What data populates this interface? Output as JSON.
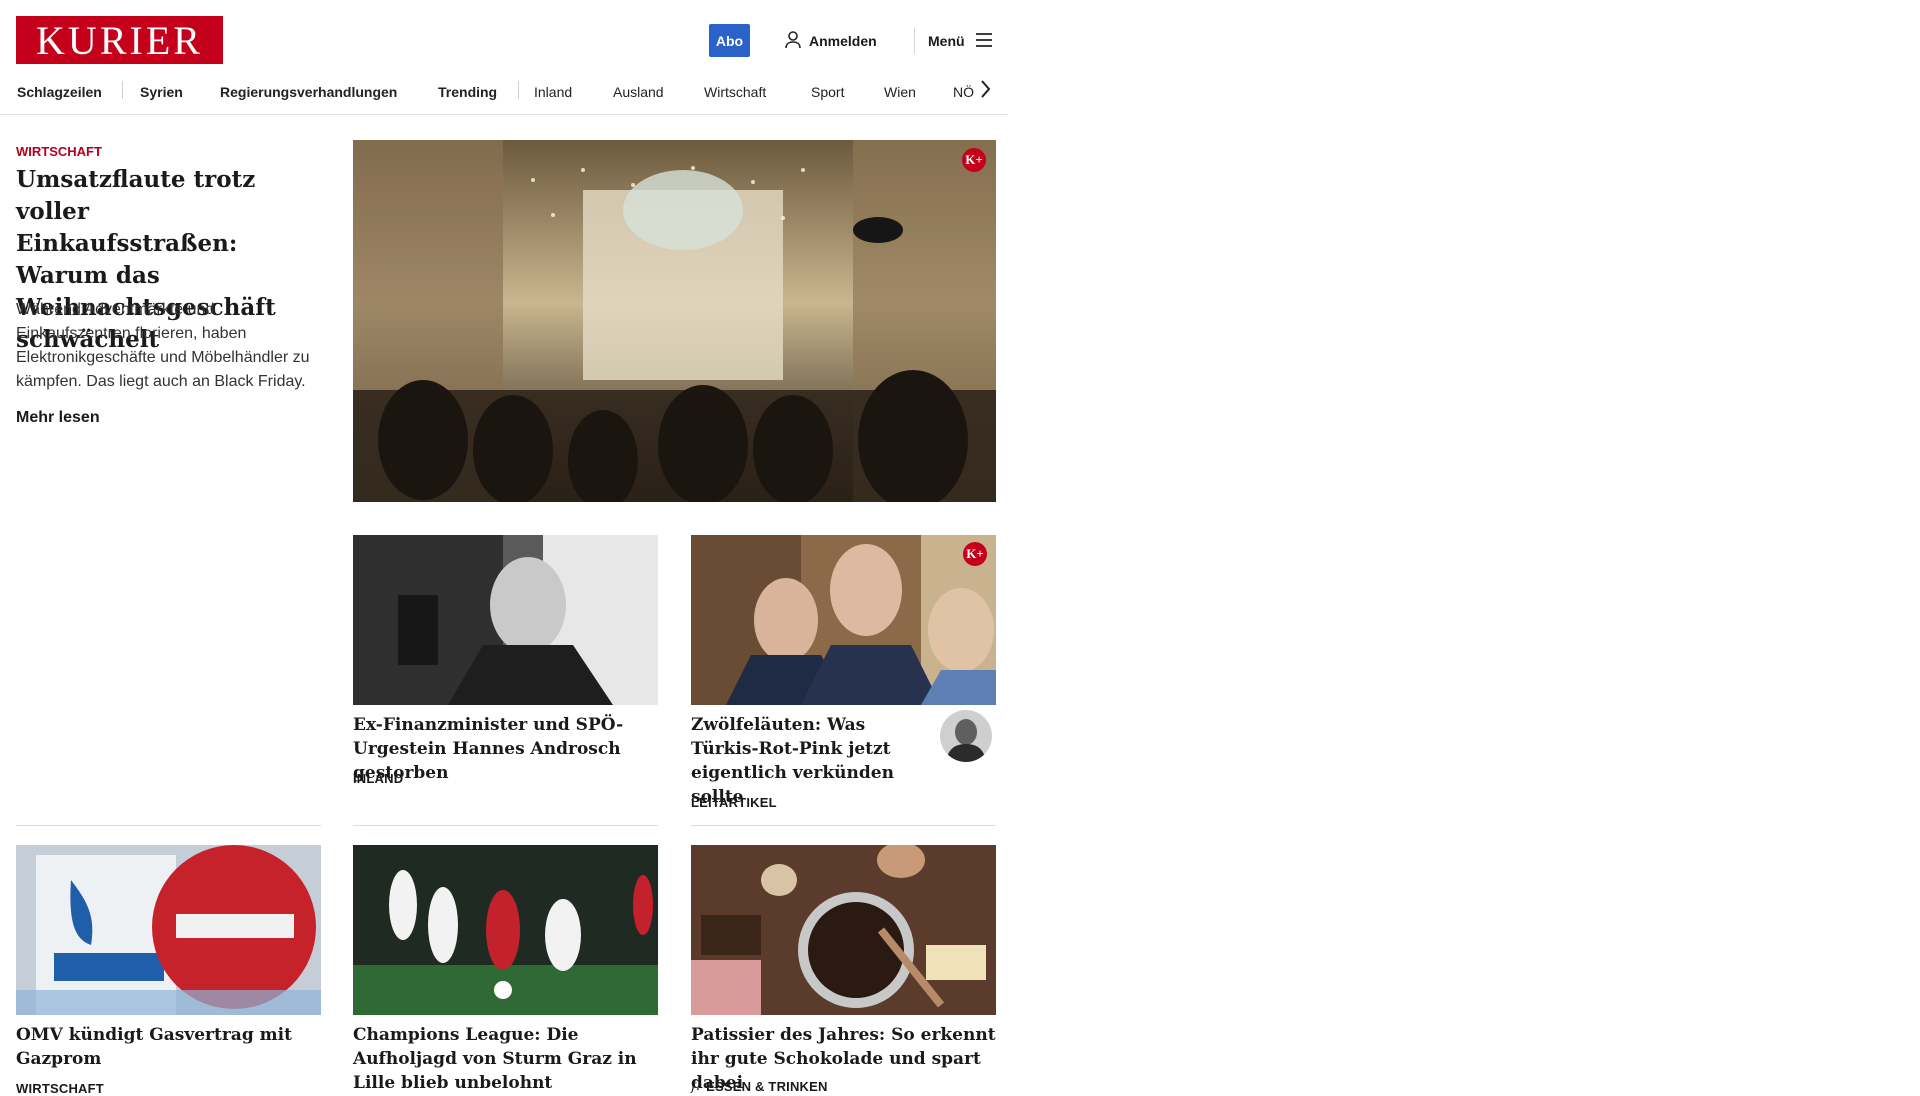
{
  "header": {
    "logo_text": "KURIER",
    "abo_label": "Abo",
    "login_label": "Anmelden",
    "menu_label": "Menü"
  },
  "nav": {
    "items": [
      "Schlagzeilen",
      "Syrien",
      "Regierungsverhandlungen",
      "Trending",
      "Inland",
      "Ausland",
      "Wirtschaft",
      "Sport",
      "Wien",
      "NÖ"
    ]
  },
  "hero": {
    "kicker": "Wirtschaft",
    "title": "Umsatzflaute trotz voller Einkaufsstraßen: Warum das Weihnachtsgeschäft schwächelt",
    "teaser": "Während Adventmärkte und Einkaufszentren florieren, haben Elektronikgeschäfte und Möbelhändler zu kämpfen. Das liegt auch an Black Friday.",
    "more_label": "Mehr lesen",
    "plus_badge": "K+"
  },
  "cards": [
    {
      "title": "Ex-Finanzminister und SPÖ-Urgestein Hannes Androsch gestorben",
      "category": "Inland"
    },
    {
      "title": "Zwölfeläuten: Was Türkis-Rot-Pink jetzt eigentlich verkünden sollte",
      "category": "Leitartikel",
      "plus_badge": "K+"
    },
    {
      "title": "OMV kündigt Gasvertrag mit Gazprom",
      "category": "Wirtschaft"
    },
    {
      "title": "Champions League: Die Aufholjagd von Sturm Graz in Lille blieb unbelohnt",
      "category": ""
    },
    {
      "title": "Patissier des Jahres: So erkennt ihr gute Schokolade und spart dabei",
      "category": "Essen & Trinken"
    }
  ],
  "icons": {
    "user": "user-icon",
    "menu": "hamburger-icon",
    "nav_next": "chevron-right-icon",
    "food": "fork-icon"
  },
  "colors": {
    "brand_red": "#c4001a",
    "abo_blue": "#2a62c9"
  }
}
